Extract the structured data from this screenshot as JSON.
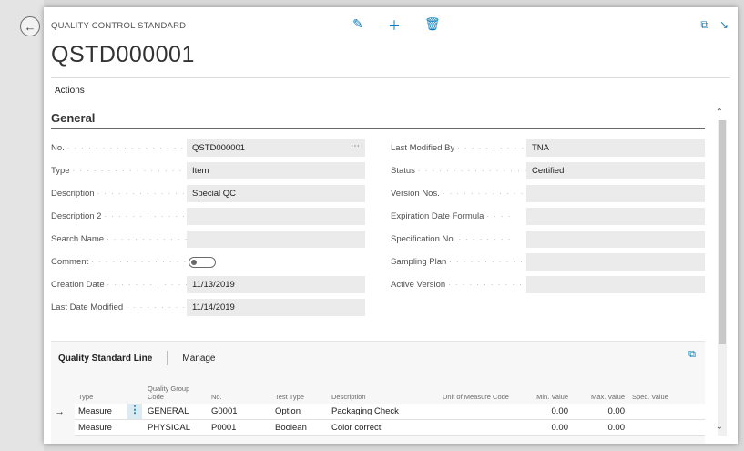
{
  "header": {
    "caption": "QUALITY CONTROL STANDARD",
    "title": "QSTD000001",
    "actions_label": "Actions"
  },
  "icons": {
    "back": "back-arrow-icon",
    "edit": "pencil-icon",
    "add": "plus-icon",
    "delete": "trash-icon",
    "open_new": "open-new-window-icon",
    "collapse": "collapse-icon",
    "expand_lines": "expand-icon"
  },
  "section": {
    "title": "General"
  },
  "fields_left": [
    {
      "label": "No.",
      "value": "QSTD000001"
    },
    {
      "label": "Type",
      "value": "Item"
    },
    {
      "label": "Description",
      "value": "Special QC"
    },
    {
      "label": "Description 2",
      "value": ""
    },
    {
      "label": "Search Name",
      "value": ""
    },
    {
      "label": "Comment",
      "value": ""
    },
    {
      "label": "Creation Date",
      "value": "11/13/2019"
    },
    {
      "label": "Last Date Modified",
      "value": "11/14/2019"
    }
  ],
  "fields_right": [
    {
      "label": "Last Modified By",
      "value": "TNA"
    },
    {
      "label": "Status",
      "value": "Certified"
    },
    {
      "label": "Version Nos.",
      "value": ""
    },
    {
      "label": "Expiration Date Formula",
      "value": ""
    },
    {
      "label": "Specification No.",
      "value": ""
    },
    {
      "label": "Sampling Plan",
      "value": ""
    },
    {
      "label": "Active Version",
      "value": ""
    }
  ],
  "lines": {
    "tab_title": "Quality Standard Line",
    "tab_manage": "Manage",
    "columns": {
      "type": "Type",
      "group_code": "Quality Group Code",
      "no": "No.",
      "test_type": "Test Type",
      "description": "Description",
      "uom": "Unit of Measure Code",
      "min": "Min. Value",
      "max": "Max. Value",
      "spec": "Spec. Value"
    },
    "rows": [
      {
        "type": "Measure",
        "group_code": "GENERAL",
        "no": "G0001",
        "test_type": "Option",
        "description": "Packaging Check",
        "uom": "",
        "min": "0.00",
        "max": "0.00",
        "spec": ""
      },
      {
        "type": "Measure",
        "group_code": "PHYSICAL",
        "no": "P0001",
        "test_type": "Boolean",
        "description": "Color correct",
        "uom": "",
        "min": "0.00",
        "max": "0.00",
        "spec": ""
      }
    ]
  },
  "colors": {
    "accent": "#0a7bb8",
    "field_bg": "#ebebeb",
    "lines_bg": "#f7f7f7"
  }
}
